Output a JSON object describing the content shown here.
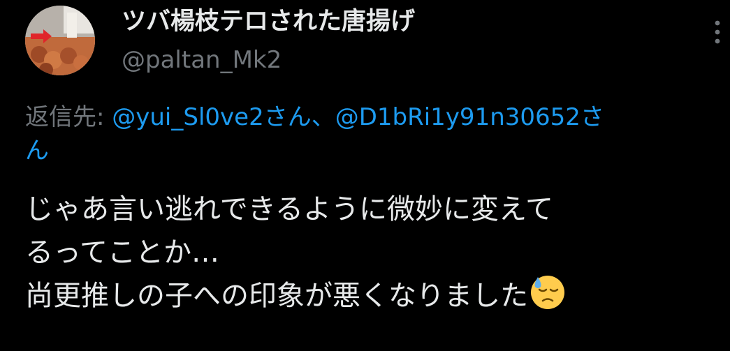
{
  "author": {
    "display_name": "ツバ楊枝テロされた唐揚げ",
    "handle": "@paltan_Mk2"
  },
  "more_icon": "more-vertical-icon",
  "reply": {
    "prefix": "返信先: ",
    "mention_1": "@yui_Sl0ve2さん",
    "separator": "、",
    "mention_2_part1": "@D1bRi1y91n30652さ",
    "mention_2_part2": "ん"
  },
  "body": {
    "line_1": "じゃあ言い逃れできるように微妙に変えて",
    "line_2": "るってことか…",
    "line_3": "尚更推しの子への印象が悪くなりました",
    "emoji": "downcast-face-with-sweat-emoji"
  },
  "colors": {
    "background": "#000000",
    "text": "#e7e9ea",
    "secondary": "#71767b",
    "link": "#1d9bf0"
  }
}
